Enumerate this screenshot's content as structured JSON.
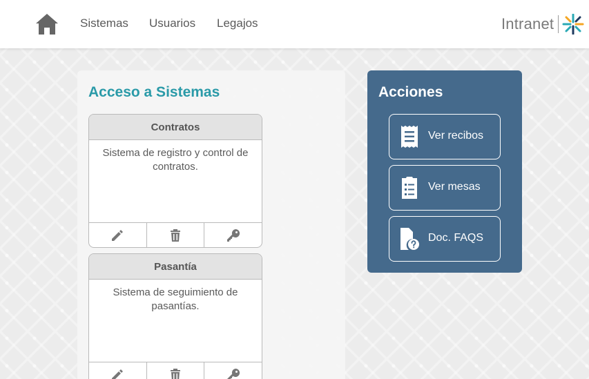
{
  "header": {
    "nav": [
      {
        "label": "Sistemas"
      },
      {
        "label": "Usuarios"
      },
      {
        "label": "Legajos"
      }
    ],
    "brand": "Intranet",
    "home_icon": "home-icon",
    "logo_icon": "asterisk-logo"
  },
  "systems": {
    "title": "Acceso a Sistemas",
    "cards": [
      {
        "name": "Contratos",
        "description": "Sistema de registro y control de contratos.",
        "actions": [
          "pencil-icon",
          "trash-icon",
          "key-icon"
        ]
      },
      {
        "name": "Pasantía",
        "description": "Sistema de seguimiento de pasantías.",
        "actions": [
          "pencil-icon",
          "trash-icon",
          "key-icon"
        ]
      }
    ]
  },
  "actions": {
    "title": "Acciones",
    "buttons": [
      {
        "label": "Ver recibos",
        "icon": "receipt-icon"
      },
      {
        "label": "Ver mesas",
        "icon": "clipboard-list-icon"
      },
      {
        "label": "Doc. FAQS",
        "icon": "file-question-icon"
      }
    ]
  },
  "colors": {
    "accent": "#2a9aa8",
    "actions_panel": "#456a8c",
    "logo_teal": "#2aa9b5",
    "logo_orange": "#f5a623",
    "logo_navy": "#1e3a5f"
  }
}
